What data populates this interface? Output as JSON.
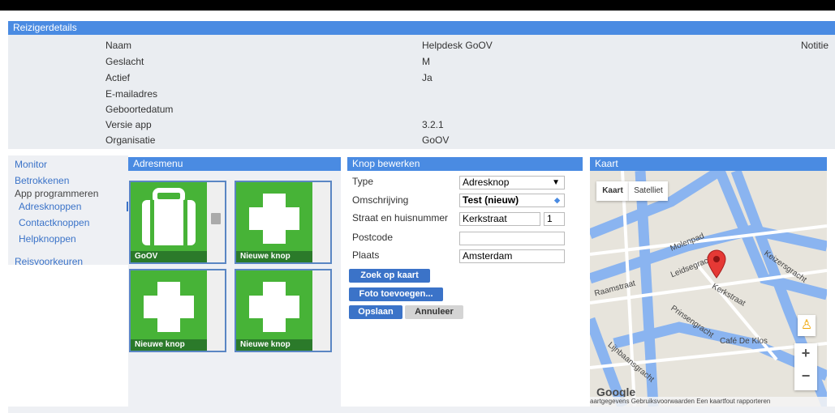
{
  "reiziger": {
    "title": "Reizigerdetails",
    "notitie": "Notitie",
    "fields": [
      {
        "label": "Naam",
        "value": "Helpdesk GoOV"
      },
      {
        "label": "Geslacht",
        "value": "M"
      },
      {
        "label": "Actief",
        "value": "Ja"
      },
      {
        "label": "E-mailadres",
        "value": ""
      },
      {
        "label": "Geboortedatum",
        "value": ""
      },
      {
        "label": "Versie app",
        "value": "3.2.1"
      },
      {
        "label": "Organisatie",
        "value": "GoOV"
      }
    ]
  },
  "nav": {
    "monitor": "Monitor",
    "betrokkenen": "Betrokkenen",
    "app_programmeren": "App programmeren",
    "adresknoppen": "Adresknoppen",
    "contactknoppen": "Contactknoppen",
    "helpknoppen": "Helpknoppen",
    "reisvoorkeuren": "Reisvoorkeuren"
  },
  "adresmenu": {
    "title": "Adresmenu",
    "tiles": [
      "GoOV",
      "Nieuwe knop",
      "Nieuwe knop",
      "Nieuwe knop"
    ]
  },
  "knop": {
    "title": "Knop bewerken",
    "type_label": "Type",
    "type_value": "Adresknop",
    "omschrijving_label": "Omschrijving",
    "omschrijving_value": "Test (nieuw)",
    "straat_label": "Straat en huisnummer",
    "straat_value": "Kerkstraat",
    "huisnummer_value": "1",
    "postcode_label": "Postcode",
    "postcode_value": "",
    "plaats_label": "Plaats",
    "plaats_value": "Amsterdam",
    "zoek_button": "Zoek op kaart",
    "foto_button": "Foto toevoegen...",
    "opslaan_button": "Opslaan",
    "annuleer_button": "Annuleer"
  },
  "kaart": {
    "title": "Kaart",
    "tab_kaart": "Kaart",
    "tab_satelliet": "Satelliet",
    "streets": [
      "Molenpad",
      "Leidsegracht",
      "Keizersgracht",
      "Raamstraat",
      "Kerkstraat",
      "Prinsengracht",
      "Lijnbaansgracht",
      "Café De Klos"
    ],
    "footer": "aartgegevens   Gebruiksvoorwaarden   Een kaartfout rapporteren",
    "logo": "Google"
  }
}
